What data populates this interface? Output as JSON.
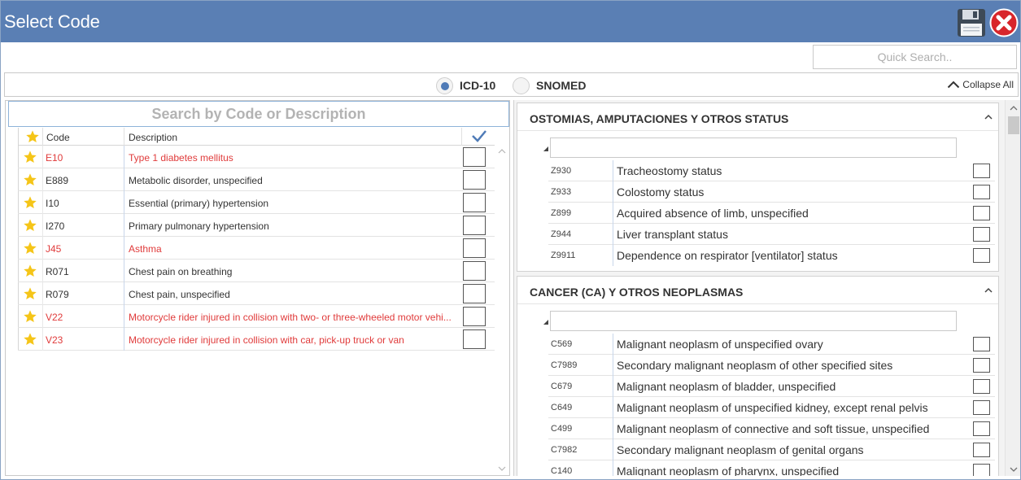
{
  "window": {
    "title": "Select Code"
  },
  "toolbar": {
    "save_icon": "floppy-disk-icon",
    "close_icon": "red-x-close-icon"
  },
  "quick_search": {
    "placeholder": "Quick Search.."
  },
  "code_system": {
    "options": [
      {
        "label": "ICD-10",
        "selected": true
      },
      {
        "label": "SNOMED",
        "selected": false
      }
    ],
    "collapse_all": "Collapse All"
  },
  "favorites": {
    "search_placeholder": "Search by Code or Description",
    "columns": {
      "code": "Code",
      "description": "Description"
    },
    "rows": [
      {
        "code": "E10",
        "description": "Type 1 diabetes mellitus",
        "highlight": true
      },
      {
        "code": "E889",
        "description": "Metabolic disorder, unspecified",
        "highlight": false
      },
      {
        "code": "I10",
        "description": "Essential (primary) hypertension",
        "highlight": false
      },
      {
        "code": "I270",
        "description": "Primary pulmonary hypertension",
        "highlight": false
      },
      {
        "code": "J45",
        "description": "Asthma",
        "highlight": true
      },
      {
        "code": "R071",
        "description": "Chest pain on breathing",
        "highlight": false
      },
      {
        "code": "R079",
        "description": "Chest pain, unspecified",
        "highlight": false
      },
      {
        "code": "V22",
        "description": "Motorcycle rider injured in collision with two- or three-wheeled motor vehi...",
        "highlight": true
      },
      {
        "code": "V23",
        "description": "Motorcycle rider injured in collision with car, pick-up truck or van",
        "highlight": true
      }
    ]
  },
  "categories": [
    {
      "title": "OSTOMIAS, AMPUTACIONES Y OTROS STATUS",
      "rows": [
        {
          "code": "Z930",
          "description": "Tracheostomy status"
        },
        {
          "code": "Z933",
          "description": "Colostomy status"
        },
        {
          "code": "Z899",
          "description": "Acquired absence of limb, unspecified"
        },
        {
          "code": "Z944",
          "description": "Liver transplant status"
        },
        {
          "code": "Z9911",
          "description": "Dependence on respirator [ventilator] status"
        }
      ]
    },
    {
      "title": "CANCER (CA) Y OTROS NEOPLASMAS",
      "rows": [
        {
          "code": "C569",
          "description": "Malignant neoplasm of unspecified ovary"
        },
        {
          "code": "C7989",
          "description": "Secondary malignant neoplasm of other specified sites"
        },
        {
          "code": "C679",
          "description": "Malignant neoplasm of bladder, unspecified"
        },
        {
          "code": "C649",
          "description": "Malignant neoplasm of unspecified kidney, except renal pelvis"
        },
        {
          "code": "C499",
          "description": "Malignant neoplasm of connective and soft tissue, unspecified"
        },
        {
          "code": "C7982",
          "description": "Secondary malignant neoplasm of genital organs"
        },
        {
          "code": "C140",
          "description": "Malignant neoplasm of pharynx, unspecified"
        }
      ]
    }
  ],
  "colors": {
    "titlebar": "#5a7fb4",
    "highlight_text": "#e03b3b",
    "star": "#f5c518",
    "radio_selected": "#4f7bb7"
  }
}
